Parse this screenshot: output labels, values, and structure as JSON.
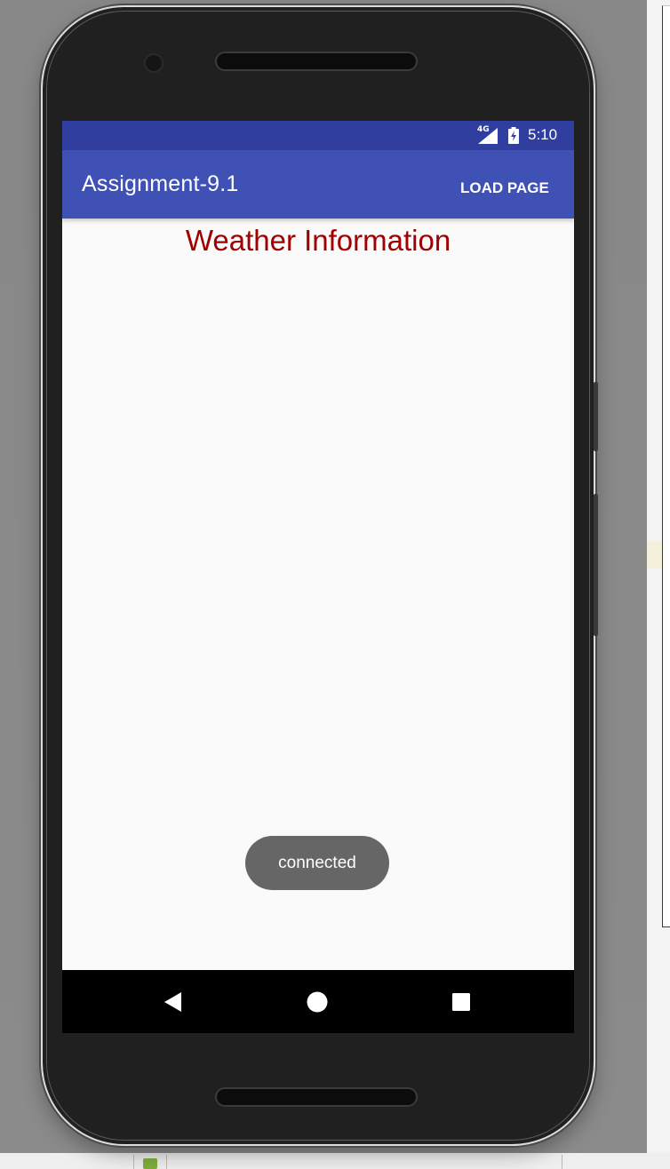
{
  "status_bar": {
    "network_type": "4G",
    "time": "5:10",
    "signal_icon": "signal-icon",
    "battery_icon": "battery-charging-icon"
  },
  "app_bar": {
    "title": "Assignment-9.1",
    "action_label": "LOAD PAGE",
    "color": "#3f51b5",
    "status_color": "#303f9f"
  },
  "main": {
    "heading": "Weather Information",
    "heading_color": "#a00000"
  },
  "toast": {
    "message": "connected"
  },
  "nav_bar": {
    "back_icon": "back-triangle-icon",
    "home_icon": "home-circle-icon",
    "recents_icon": "recents-square-icon"
  }
}
